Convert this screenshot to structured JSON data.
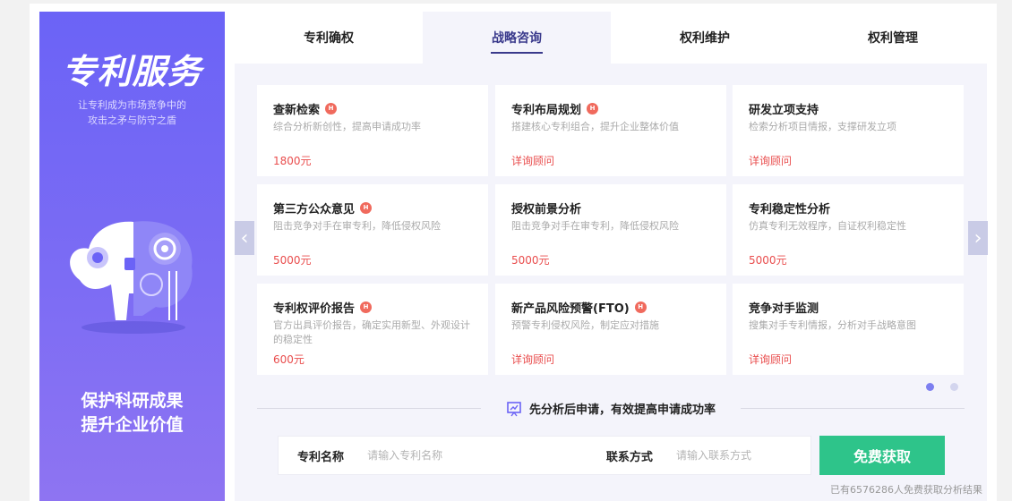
{
  "banner": {
    "title": "专利服务",
    "sub_line1": "让专利成为市场竞争中的",
    "sub_line2": "攻击之矛与防守之盾",
    "slogan_line1": "保护科研成果",
    "slogan_line2": "提升企业价值"
  },
  "tabs": [
    {
      "label": "专利确权"
    },
    {
      "label": "战略咨询"
    },
    {
      "label": "权利维护"
    },
    {
      "label": "权利管理"
    }
  ],
  "hot_badge": "H",
  "cards": [
    {
      "title": "查新检索",
      "desc": "综合分析新创性，提高申请成功率",
      "price": "1800元"
    },
    {
      "title": "专利布局规划",
      "desc": "搭建核心专利组合，提升企业整体价值",
      "price": "详询顾问"
    },
    {
      "title": "研发立项支持",
      "desc": "检索分析项目情报，支撑研发立项",
      "price": "详询顾问"
    },
    {
      "title": "第三方公众意见",
      "desc": "阻击竞争对手在审专利，降低侵权风险",
      "price": "5000元"
    },
    {
      "title": "授权前景分析",
      "desc": "阻击竞争对手在审专利，降低侵权风险",
      "price": "5000元"
    },
    {
      "title": "专利稳定性分析",
      "desc": "仿真专利无效程序，自证权利稳定性",
      "price": "5000元"
    },
    {
      "title": "专利权评价报告",
      "desc": "官方出具评价报告，确定实用新型、外观设计的稳定性",
      "price": "600元"
    },
    {
      "title": "新产品风险预警(FTO)",
      "desc": "预警专利侵权风险，制定应对措施",
      "price": "详询顾问"
    },
    {
      "title": "竞争对手监测",
      "desc": "搜集对手专利情报，分析对手战略意图",
      "price": "详询顾问"
    }
  ],
  "divider_text": "先分析后申请，有效提高申请成功率",
  "form": {
    "name_label": "专利名称",
    "name_placeholder": "请输入专利名称",
    "contact_label": "联系方式",
    "contact_placeholder": "请输入联系方式",
    "submit_label": "免费获取"
  },
  "count_note": "已有6576286人免费获取分析结果",
  "colors": {
    "accent": "#3a3a8c",
    "price": "#e94d4d",
    "submit": "#2ec48a",
    "banner": "#6b63f6"
  },
  "icons": {
    "prev": "chevron-left-icon",
    "next": "chevron-right-icon",
    "hot": "hot-badge-icon",
    "divider": "analysis-board-icon"
  }
}
